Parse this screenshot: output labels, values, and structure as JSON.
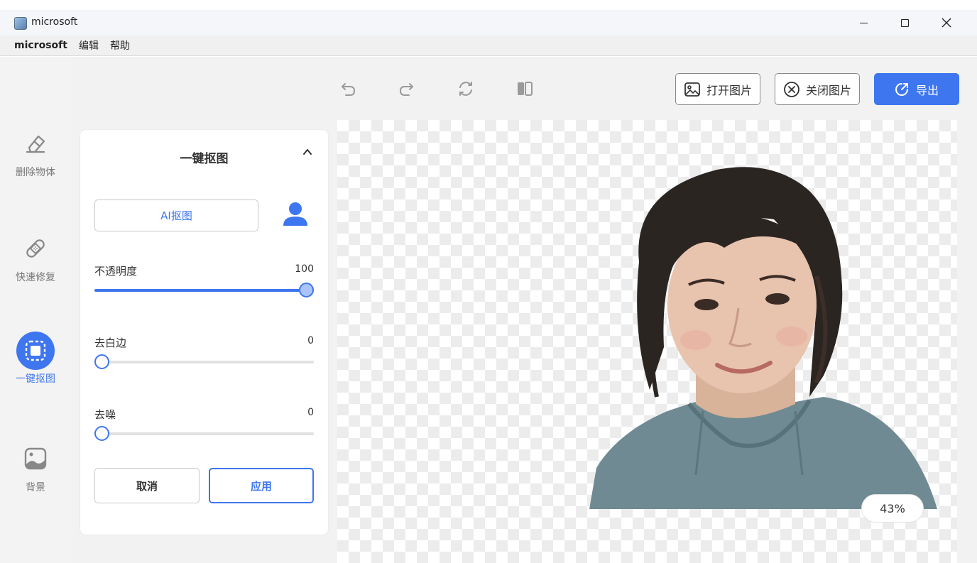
{
  "window": {
    "title": "microsoft",
    "controls": [
      "minimize",
      "maximize",
      "close"
    ]
  },
  "menu": {
    "brand": "microsoft",
    "items": [
      "编辑",
      "帮助"
    ]
  },
  "sidebar": {
    "items": [
      {
        "label": "删除物体",
        "icon": "eraser-icon",
        "active": false
      },
      {
        "label": "快速修复",
        "icon": "bandage-icon",
        "active": false
      },
      {
        "label": "一键抠图",
        "icon": "cutout-icon",
        "active": true
      },
      {
        "label": "背景",
        "icon": "image-icon",
        "active": false
      }
    ]
  },
  "toolbar": {
    "icons": [
      "undo-icon",
      "redo-icon",
      "refresh-icon",
      "compare-icon"
    ],
    "open_label": "打开图片",
    "close_label": "关闭图片",
    "export_label": "导出"
  },
  "panel": {
    "title": "一键抠图",
    "ai_button": "AI抠图",
    "sliders": [
      {
        "label": "不透明度",
        "value": "100",
        "fraction": 1.0
      },
      {
        "label": "去白边",
        "value": "0",
        "fraction": 0.0
      },
      {
        "label": "去噪",
        "value": "0",
        "fraction": 0.0
      }
    ],
    "cancel_label": "取消",
    "apply_label": "应用"
  },
  "canvas": {
    "zoom": "43%"
  },
  "colors": {
    "accent": "#3e76f0",
    "nav_bg": "#f3f3f3",
    "main_bg": "#f2f2f2"
  }
}
